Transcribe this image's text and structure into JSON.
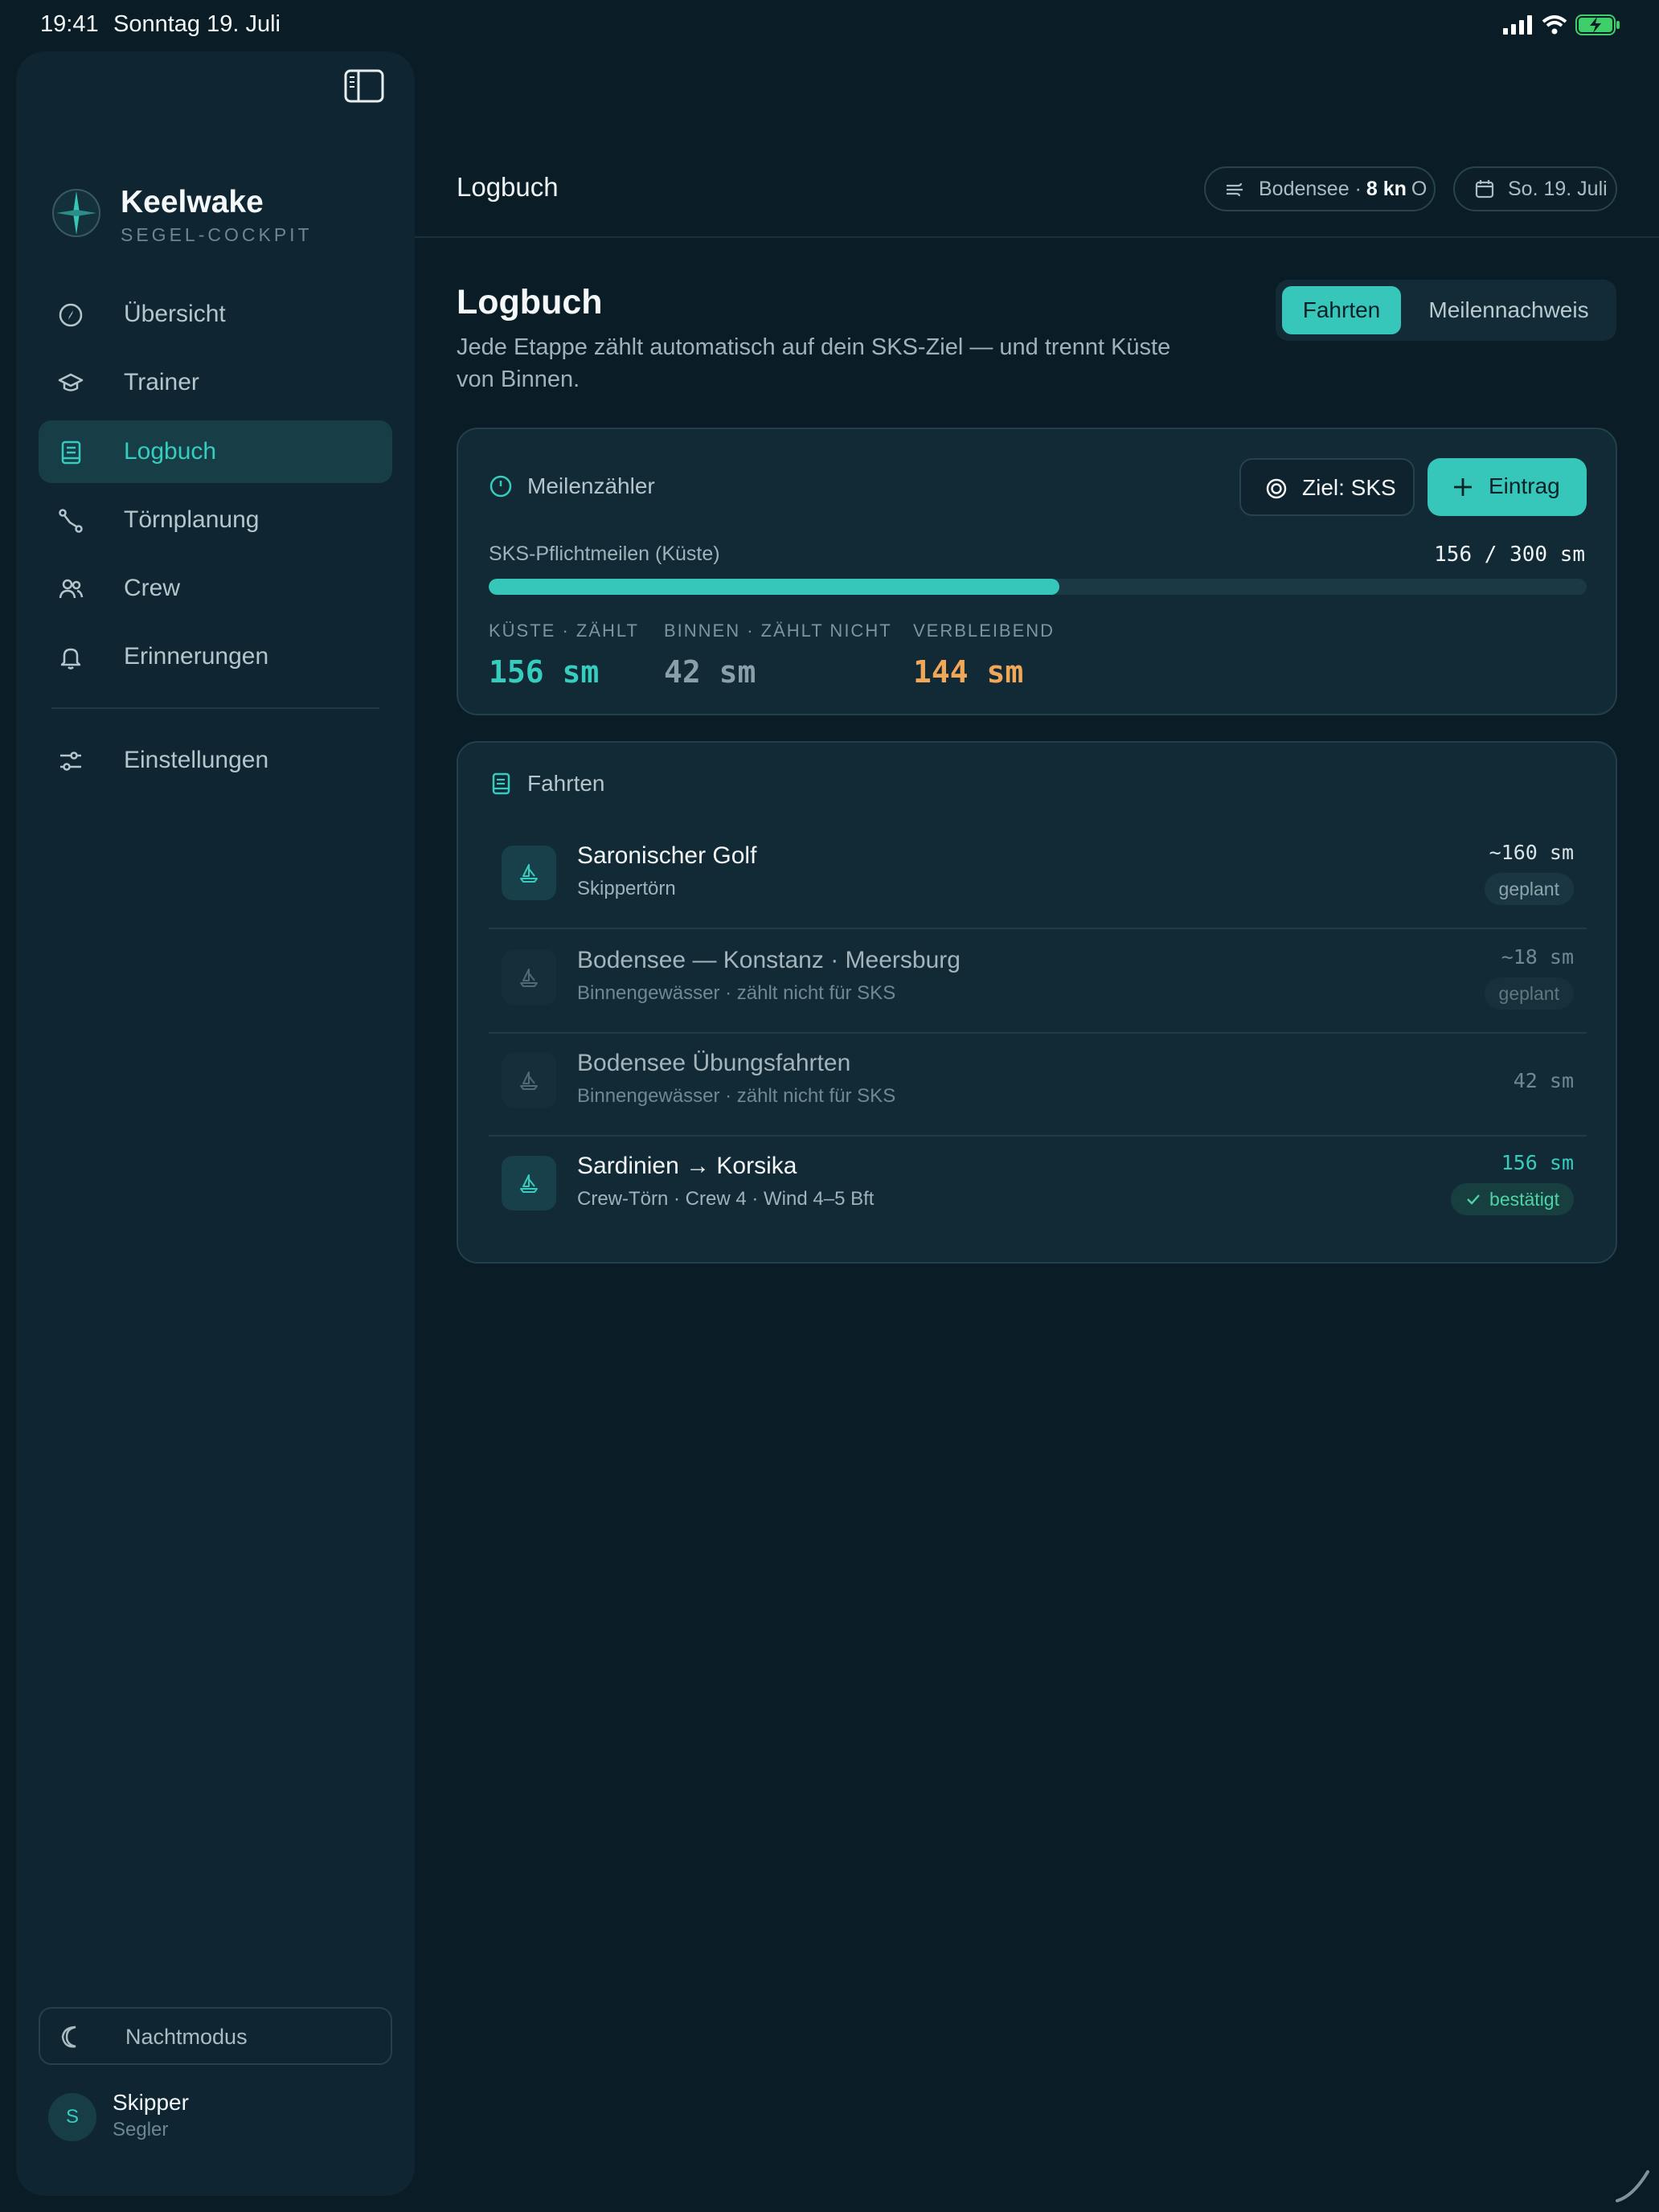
{
  "status_bar": {
    "time": "19:41",
    "date": "Sonntag 19. Juli"
  },
  "sidebar": {
    "brand_name": "Keelwake",
    "brand_sub": "SEGEL-COCKPIT",
    "items": [
      {
        "label": "Übersicht",
        "icon": "compass-icon"
      },
      {
        "label": "Trainer",
        "icon": "graduation-cap-icon"
      },
      {
        "label": "Logbuch",
        "icon": "book-icon",
        "active": true
      },
      {
        "label": "Törnplanung",
        "icon": "route-icon"
      },
      {
        "label": "Crew",
        "icon": "users-icon"
      },
      {
        "label": "Erinnerungen",
        "icon": "bell-icon"
      }
    ],
    "settings": {
      "label": "Einstellungen",
      "icon": "sliders-icon"
    },
    "night_mode": "Nachtmodus",
    "user": {
      "initial": "S",
      "name": "Skipper",
      "role": "Segler"
    }
  },
  "topbar": {
    "title": "Logbuch",
    "weather": {
      "place": "Bodensee ·",
      "wind": "8 kn",
      "dir": "O"
    },
    "date": "So. 19. Juli"
  },
  "page": {
    "title": "Logbuch",
    "description": "Jede Etappe zählt automatisch auf dein SKS-Ziel — und trennt Küste von Binnen.",
    "tabs": [
      "Fahrten",
      "Meilennachweis"
    ]
  },
  "counter": {
    "title": "Meilenzähler",
    "goal_label": "Ziel: SKS",
    "add_label": "Eintrag",
    "progress_label": "SKS-Pflichtmeilen (Küste)",
    "progress_text": "156 / 300 sm",
    "progress_fraction": 0.52,
    "stats": [
      {
        "label": "KÜSTE · ZÄHLT",
        "value": "156 sm"
      },
      {
        "label": "BINNEN · ZÄHLT NICHT",
        "value": "42 sm"
      },
      {
        "label": "VERBLEIBEND",
        "value": "144 sm"
      }
    ]
  },
  "trips": {
    "title": "Fahrten",
    "rows": [
      {
        "title": "Saronischer Golf",
        "sub": "Skippertörn",
        "dist": "~160 sm",
        "badge": "geplant"
      },
      {
        "title": "Bodensee — Konstanz · Meersburg",
        "sub": "Binnengewässer · zählt nicht für SKS",
        "dist": "~18 sm",
        "badge": "geplant"
      },
      {
        "title": "Bodensee Übungsfahrten",
        "sub": "Binnengewässer · zählt nicht für SKS",
        "dist": "42 sm",
        "badge": ""
      },
      {
        "title": "Sardinien → Korsika",
        "sub": "Crew-Törn · Crew 4 · Wind 4–5 Bft",
        "dist": "156 sm",
        "badge": "bestätigt"
      }
    ]
  },
  "colors": {
    "accent": "#36c7ba",
    "background": "#0a1c25",
    "warning": "#f0a757",
    "success": "#4ed3a3"
  }
}
